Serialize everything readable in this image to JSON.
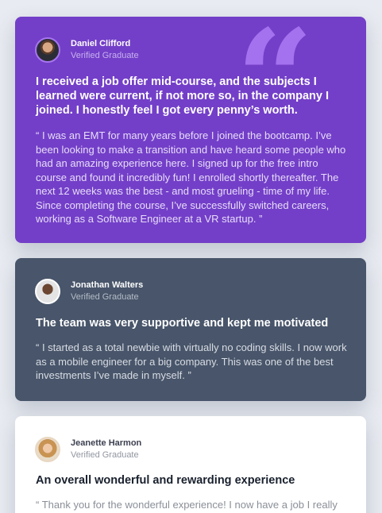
{
  "colors": {
    "page_background": "#e8ebf1",
    "purple_card": "#733fc8",
    "slate_card": "#48556a",
    "white_card": "#ffffff",
    "quote_mark": "#a775f1"
  },
  "testimonials": [
    {
      "name": "Daniel Clifford",
      "status": "Verified Graduate",
      "headline": "I received a job offer mid-course, and the subjects I learned were current, if not more so, in the company I joined. I honestly feel I got every penny’s worth.",
      "quote": "“ I was an EMT for many years before I joined the bootcamp. I’ve been looking to make a transition and have heard some people who had an amazing experience here. I signed up for the free intro course and found it incredibly fun! I enrolled shortly thereafter. The next 12 weeks was the best - and most grueling - time of my life. Since completing the course, I’ve successfully switched careers, working as a Software Engineer at a VR startup. ”"
    },
    {
      "name": "Jonathan Walters",
      "status": "Verified Graduate",
      "headline": "The team was very supportive and kept me motivated",
      "quote": "“ I started as a total newbie with virtually no coding skills. I now work as a mobile engineer for a big company. This was one of the best investments I’ve made in myself. ”"
    },
    {
      "name": "Jeanette Harmon",
      "status": "Verified Graduate",
      "headline": "An overall wonderful and rewarding experience",
      "quote": "“ Thank you for the wonderful experience! I now have a job I really"
    }
  ],
  "icons": {
    "quote": "quote-icon",
    "avatar": "avatar"
  }
}
